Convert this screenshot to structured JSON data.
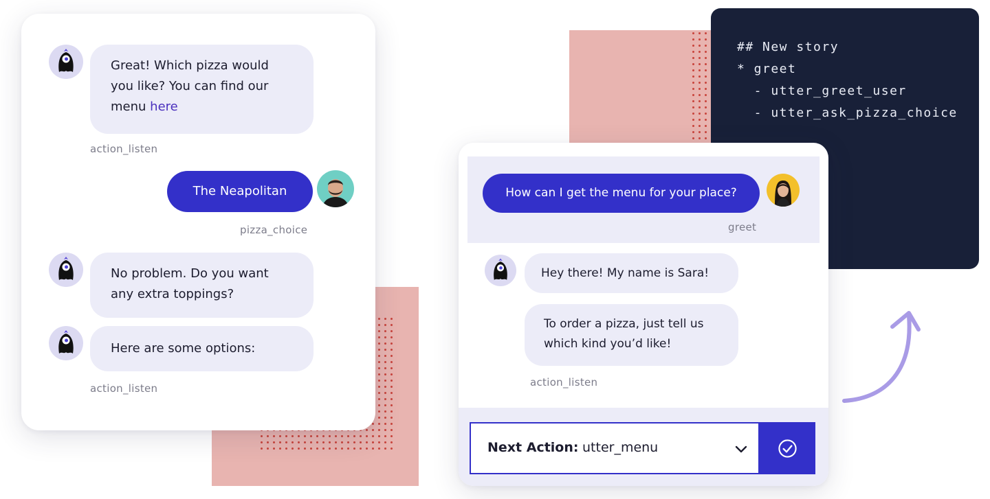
{
  "left_chat": {
    "bot_message_1": {
      "text": "Great! Which pizza would you like? You can find our menu ",
      "link": "here"
    },
    "label_1": "action_listen",
    "user_message": "The Neapolitan",
    "label_2": "pizza_choice",
    "bot_message_2": "No problem. Do you want any extra toppings?",
    "bot_message_3": "Here are some options:",
    "label_3": "action_listen"
  },
  "code": {
    "lines": [
      "## New story",
      "* greet",
      "  - utter_greet_user",
      "  - utter_ask_pizza_choice"
    ]
  },
  "right_chat": {
    "user_message": "How can I get the menu for your place?",
    "user_label": "greet",
    "bot_message_1": "Hey there! My name is Sara!",
    "bot_message_2": "To order a pizza, just tell us which kind you’d like!",
    "bot_label": "action_listen",
    "next_action": {
      "label": "Next Action:",
      "value": "utter_menu"
    }
  },
  "colors": {
    "accent": "#3330c9",
    "bubble": "#ececf8",
    "code_bg": "#182038",
    "pink": "#e8b4b0",
    "arrow": "#a99be6"
  },
  "icons": [
    "bot-mascot-icon",
    "user-avatar-male",
    "user-avatar-female",
    "chevron-down-icon",
    "check-circle-icon",
    "curved-arrow-icon"
  ]
}
